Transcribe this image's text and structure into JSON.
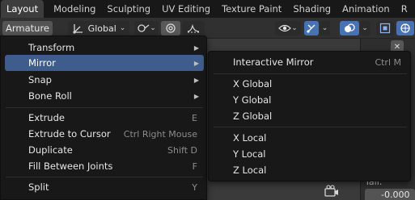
{
  "workspace_tabs": [
    {
      "label": "Layout",
      "active": true
    },
    {
      "label": "Modeling"
    },
    {
      "label": "Sculpting"
    },
    {
      "label": "UV Editing"
    },
    {
      "label": "Texture Paint"
    },
    {
      "label": "Shading"
    },
    {
      "label": "Animation"
    },
    {
      "label": "R"
    }
  ],
  "header": {
    "menu_label": "Armature",
    "transform_orientation": "Global"
  },
  "main_menu": {
    "items": [
      {
        "label": "Transform",
        "submenu": true
      },
      {
        "label": "Mirror",
        "submenu": true,
        "highlighted": true
      },
      {
        "label": "Snap",
        "submenu": true
      },
      {
        "label": "Bone Roll",
        "submenu": true
      },
      {
        "label": "Extrude",
        "shortcut": "E"
      },
      {
        "label": "Extrude to Cursor",
        "shortcut": "Ctrl Right Mouse"
      },
      {
        "label": "Duplicate",
        "shortcut": "Shift D"
      },
      {
        "label": "Fill Between Joints",
        "shortcut": "F"
      },
      {
        "label": "Split",
        "shortcut": "Y"
      }
    ]
  },
  "mirror_menu": {
    "items": [
      {
        "label": "Interactive Mirror",
        "shortcut": "Ctrl M"
      },
      {
        "label": "X Global"
      },
      {
        "label": "Y Global"
      },
      {
        "label": "Z Global"
      },
      {
        "label": "X Local"
      },
      {
        "label": "Y Local"
      },
      {
        "label": "Z Local"
      }
    ]
  },
  "sidebar": {
    "label": "Tail:",
    "value": "-0.000"
  },
  "icons": {
    "accent": "#4772b3",
    "highlight": "#3e5d8c"
  }
}
